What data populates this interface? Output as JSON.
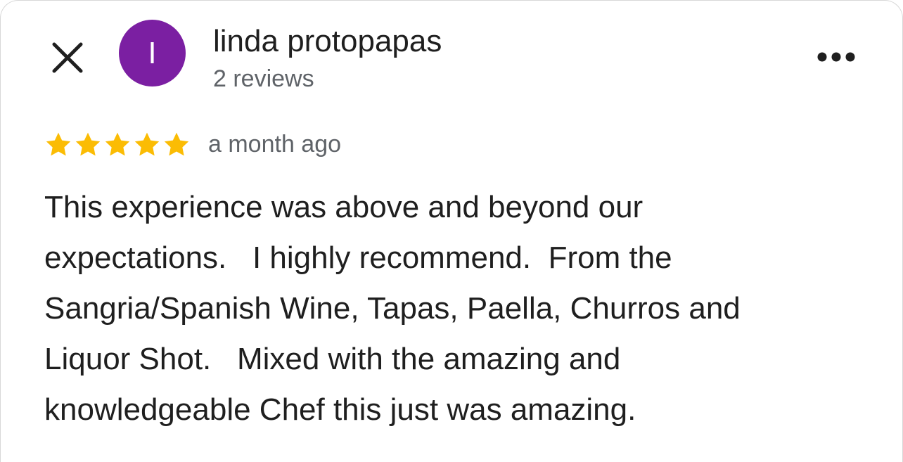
{
  "header": {
    "close_icon": "close-icon",
    "avatar_initial": "I",
    "avatar_color": "#7b1fa2",
    "reviewer_name": "linda protopapas",
    "review_count": "2 reviews",
    "more_icon": "more-horizontal-icon"
  },
  "review": {
    "rating": 5,
    "max_rating": 5,
    "star_color": "#fbbc04",
    "timestamp": "a month ago",
    "text": "This experience was above and beyond our\nexpectations.   I highly recommend.  From the\nSangria/Spanish Wine, Tapas, Paella, Churros and\nLiquor Shot.   Mixed with the amazing and\nknowledgeable Chef this just was amazing."
  }
}
